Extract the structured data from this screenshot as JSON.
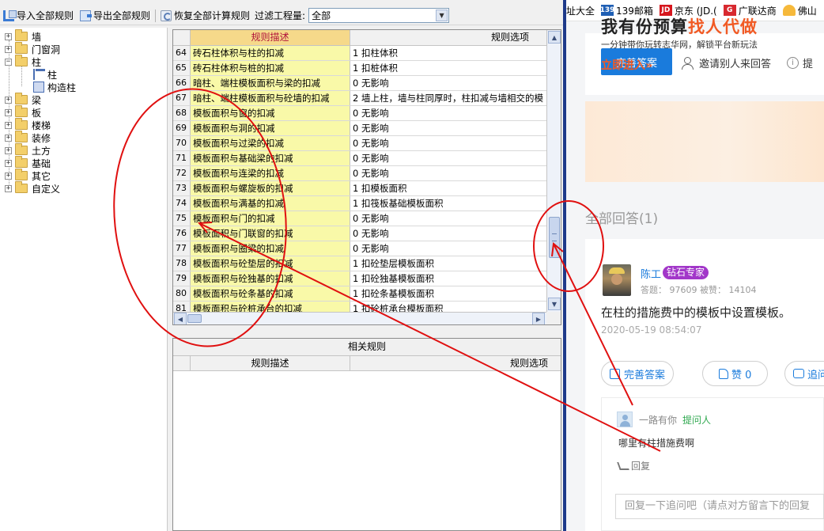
{
  "toolbar": {
    "import_label": "导入全部规则",
    "export_label": "导出全部规则",
    "restore_label": "恢复全部计算规则",
    "filter_label": "过滤工程量:",
    "filter_value": "全部"
  },
  "tree": {
    "nodes": [
      "墙",
      "门窗洞",
      "柱",
      "柱",
      "构造柱",
      "梁",
      "板",
      "楼梯",
      "装修",
      "土方",
      "基础",
      "其它",
      "自定义"
    ]
  },
  "grid": {
    "header_desc": "规则描述",
    "header_opt": "规则选项",
    "rows": [
      {
        "num": "64",
        "desc": "砖石柱体积与柱的扣减",
        "opt": "1 扣柱体积"
      },
      {
        "num": "65",
        "desc": "砖石柱体积与桩的扣减",
        "opt": "1 扣桩体积"
      },
      {
        "num": "66",
        "desc": "暗柱、端柱模板面积与梁的扣减",
        "opt": "0  无影响"
      },
      {
        "num": "67",
        "desc": "暗柱、端柱模板面积与砼墙的扣减",
        "opt": "2 墙上柱，墙与柱同厚时，柱扣减与墙相交的模"
      },
      {
        "num": "68",
        "desc": "模板面积与窗的扣减",
        "opt": "0  无影响"
      },
      {
        "num": "69",
        "desc": "模板面积与洞的扣减",
        "opt": "0  无影响"
      },
      {
        "num": "70",
        "desc": "模板面积与过梁的扣减",
        "opt": "0  无影响"
      },
      {
        "num": "71",
        "desc": "模板面积与基础梁的扣减",
        "opt": "0  无影响"
      },
      {
        "num": "72",
        "desc": "模板面积与连梁的扣减",
        "opt": "0  无影响"
      },
      {
        "num": "73",
        "desc": "模板面积与螺旋板的扣减",
        "opt": "1 扣模板面积"
      },
      {
        "num": "74",
        "desc": "模板面积与满基的扣减",
        "opt": "1 扣筏板基础模板面积"
      },
      {
        "num": "75",
        "desc": "模板面积与门的扣减",
        "opt": "0  无影响"
      },
      {
        "num": "76",
        "desc": "模板面积与门联窗的扣减",
        "opt": "0  无影响"
      },
      {
        "num": "77",
        "desc": "模板面积与圈梁的扣减",
        "opt": "0  无影响"
      },
      {
        "num": "78",
        "desc": "模板面积与砼垫层的扣减",
        "opt": "1 扣砼垫层模板面积"
      },
      {
        "num": "79",
        "desc": "模板面积与砼独基的扣减",
        "opt": "1 扣砼独基模板面积"
      },
      {
        "num": "80",
        "desc": "模板面积与砼条基的扣减",
        "opt": "1 扣砼条基模板面积"
      },
      {
        "num": "81",
        "desc": "模板面积与砼桩承台的扣减",
        "opt": "1 扣砼桩承台模板面积"
      }
    ]
  },
  "related": {
    "title": "相关规则",
    "header_desc": "规则描述",
    "header_opt": "规则选项"
  },
  "browser": {
    "bookmarks": [
      "址大全",
      "139邮箱",
      "京东 (JD.(",
      "广联达商",
      "佛山"
    ],
    "improve_btn": "完善答案",
    "invite_label": "邀请别人来回答",
    "ask_label": "提",
    "banner_title_a": "我有份预算",
    "banner_title_b": "找人代做",
    "banner_sub": "一分钟带你玩转志华网，解锁平台新玩法",
    "banner_cta": "立即进入»",
    "all_answers": "全部回答(1)",
    "answer": {
      "name": "陈工",
      "badge": "钻石专家",
      "meta": "答题： 97609    被赞： 14104",
      "text": "在柱的措施费中的模板中设置模板。",
      "time": "2020-05-19 08:54:07",
      "improve": "完善答案",
      "like": "赞 0",
      "followup": "追问"
    },
    "comment": {
      "name": "一路有你",
      "role": "提问人",
      "text": "哪里有柱措施费啊",
      "reply": "回复",
      "placeholder": "回复一下追问吧（请点对方留言下的回复"
    }
  },
  "colors": {
    "accent_blue": "#1a7bdc",
    "annotation_red": "#e01010",
    "grid_yellow": "#f9f9a8",
    "badge_purple": "#a237c9",
    "banner_orange": "#f15a24"
  }
}
